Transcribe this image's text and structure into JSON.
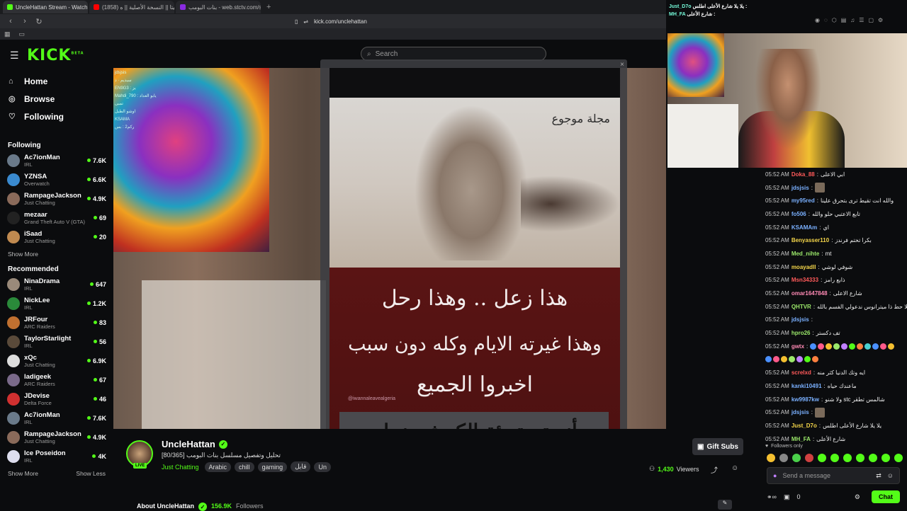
{
  "browser": {
    "tabs": [
      {
        "label": "UncleHattan Stream - Watch Liv",
        "color": "#53fc18",
        "active": true
      },
      {
        "label": "(1858) لاكت ميتا || النسخة الأصلية || ه",
        "color": "#ff0000",
        "active": false
      },
      {
        "label": "بنات البومب - web.stctv.com/search?q",
        "color": "#8a2be2",
        "active": false
      }
    ],
    "new_tab": "+",
    "url": "kick.com/unclehattan"
  },
  "topbar": {
    "logo": "KICK",
    "logo_badge": "BETA",
    "search_placeholder": "Search"
  },
  "sidebar": {
    "nav": [
      {
        "label": "Home",
        "icon": "home-icon"
      },
      {
        "label": "Browse",
        "icon": "compass-icon"
      },
      {
        "label": "Following",
        "icon": "heart-icon"
      }
    ],
    "following_title": "Following",
    "following": [
      {
        "name": "Ac7ionMan",
        "category": "IRL",
        "viewers": "7.6K",
        "color": "#6a7a8a"
      },
      {
        "name": "YZNSA",
        "category": "Overwatch",
        "viewers": "6.6K",
        "color": "#3a8acf"
      },
      {
        "name": "RampageJackson",
        "category": "Just Chatting",
        "viewers": "4.9K",
        "color": "#8a6a5a"
      },
      {
        "name": "mezaar",
        "category": "Grand Theft Auto V (GTA)",
        "viewers": "69",
        "color": "#222"
      },
      {
        "name": "iSaad",
        "category": "Just Chatting",
        "viewers": "20",
        "color": "#c08a50"
      }
    ],
    "show_more": "Show More",
    "recommended_title": "Recommended",
    "recommended": [
      {
        "name": "NinaDrama",
        "category": "IRL",
        "viewers": "647",
        "color": "#9a8a7a"
      },
      {
        "name": "NickLee",
        "category": "IRL",
        "viewers": "1.2K",
        "color": "#2a8a3a"
      },
      {
        "name": "JRFour",
        "category": "ARC Raiders",
        "viewers": "83",
        "color": "#c07030"
      },
      {
        "name": "TaylorStarlight",
        "category": "IRL",
        "viewers": "56",
        "color": "#5a4a3a"
      },
      {
        "name": "xQc",
        "category": "Just Chatting",
        "viewers": "6.9K",
        "color": "#ddd"
      },
      {
        "name": "ladigeek",
        "category": "ARC Raiders",
        "viewers": "67",
        "color": "#7a6a8a"
      },
      {
        "name": "JDevise",
        "category": "Delta Force",
        "viewers": "46",
        "color": "#d03030"
      },
      {
        "name": "Ac7ionMan",
        "category": "IRL",
        "viewers": "7.6K",
        "color": "#6a7a8a"
      },
      {
        "name": "RampageJackson",
        "category": "Just Chatting",
        "viewers": "4.9K",
        "color": "#8a6a5a"
      },
      {
        "name": "Ice Poseidon",
        "category": "IRL",
        "viewers": "4K",
        "color": "#dde"
      }
    ],
    "show_more2": "Show More",
    "show_less": "Show Less"
  },
  "post": {
    "magazine": "مجلة موجوع",
    "line1": "هذا زعل .. وهذا رحل",
    "line2": "وهذا غيرته الايام وكله دون سبب",
    "line3": "اخبروا الجميع",
    "watermark": "@iwannaleavealgeria",
    "line4": "أنه تم تعبئة الكرش بنجاح",
    "close": "×"
  },
  "stream": {
    "name": "UncleHattan",
    "title": "تحليل وتفصيل مسلسل بنات البومب [80/365]",
    "category": "Just Chatting",
    "tags": [
      "Arabic",
      "chill",
      "gaming",
      "قابل",
      "Un"
    ],
    "live": "LIVE",
    "gift": "Gift Subs",
    "viewers": "1,430",
    "viewers_label": "Viewers",
    "about": "About UncleHattan",
    "followers": "156.9K",
    "followers_label": "Followers"
  },
  "right_top": {
    "line1_user": "Just_D7o",
    "line1_text": "يلا يلا شارع الأعلى اطلس :",
    "line2_user": "MH_FA",
    "line2_text": "شارع الأعلى :"
  },
  "chat": {
    "messages": [
      {
        "time": "05:52 AM",
        "user": "Doka_88",
        "color": "#ff5a5a",
        "text": "ابي الاعلى"
      },
      {
        "time": "05:52 AM",
        "user": "jdsjsis",
        "color": "#7ab0ff",
        "text": "",
        "img": true
      },
      {
        "time": "05:52 AM",
        "user": "my95red",
        "color": "#7ab0ff",
        "text": "والله انت تقيط ترى بتحرق علينا"
      },
      {
        "time": "05:52 AM",
        "user": "fo506",
        "color": "#7ab0ff",
        "text": "تابع الاعتبي حلو والله"
      },
      {
        "time": "05:52 AM",
        "user": "KSAMAm",
        "color": "#7ab0ff",
        "text": "اي"
      },
      {
        "time": "05:52 AM",
        "user": "Benyasser110",
        "color": "#f5d64a",
        "text": "بكرا تختم فرندز"
      },
      {
        "time": "05:52 AM",
        "user": "Med_nihte",
        "color": "#9be86a",
        "text": "mt"
      },
      {
        "time": "05:52 AM",
        "user": "moayadll",
        "color": "#f5d64a",
        "text": "شوفي لوشي"
      },
      {
        "time": "05:52 AM",
        "user": "Msn34333",
        "color": "#ff5a5a",
        "text": "ذابع رامز"
      },
      {
        "time": "05:52 AM",
        "user": "omar1647848",
        "color": "#ff8ab5",
        "text": "شارع الاعلى"
      },
      {
        "time": "05:52 AM",
        "user": "QHTVR",
        "color": "#9be86a",
        "text": "يلا حط ذا ميترانوس ندعولي الفسم بالله"
      },
      {
        "time": "05:52 AM",
        "user": "jdsjsis",
        "color": "#7ab0ff",
        "text": ""
      },
      {
        "time": "05:52 AM",
        "user": "hpro26",
        "color": "#9be86a",
        "text": "تف دكستر"
      },
      {
        "time": "05:52 AM",
        "user": "gwtx",
        "color": "#ff8ab5",
        "text": "",
        "emojis": true
      },
      {
        "time": "",
        "user": "",
        "color": "#fff",
        "text": "",
        "emojis2": true
      },
      {
        "time": "05:52 AM",
        "user": "screlxd",
        "color": "#ff5a5a",
        "text": "ايه وتك الدنيا كثر منه"
      },
      {
        "time": "05:52 AM",
        "user": "kanki10491",
        "color": "#7ab0ff",
        "text": "ماعندك حياه"
      },
      {
        "time": "05:52 AM",
        "user": "kw9987kw",
        "color": "#7ab0ff",
        "text": "ولا شنو stc شالمس تطقر"
      },
      {
        "time": "05:52 AM",
        "user": "jdsjsis",
        "color": "#7ab0ff",
        "text": "",
        "img": true
      },
      {
        "time": "05:52 AM",
        "user": "Just_D7o",
        "color": "#f5d64a",
        "text": "يلا يلا شارع الأعلى اطلس"
      },
      {
        "time": "05:52 AM",
        "user": "MH_FA",
        "color": "#9be86a",
        "text": "شارع الأعلى"
      }
    ],
    "followers_only": "Followers only",
    "placeholder": "Send a message",
    "points": "0",
    "chat_button": "Chat"
  }
}
